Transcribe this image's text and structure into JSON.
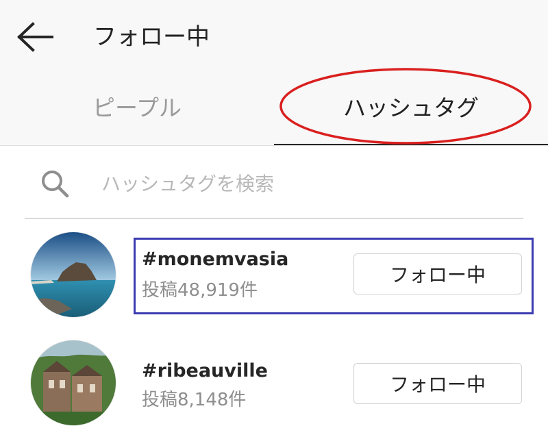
{
  "header": {
    "title": "フォロー中",
    "back_icon": "arrow-left-icon"
  },
  "tabs": [
    {
      "label": "ピープル",
      "active": false
    },
    {
      "label": "ハッシュタグ",
      "active": true
    }
  ],
  "search": {
    "placeholder": "ハッシュタグを検索",
    "value": "",
    "icon": "search-icon"
  },
  "hashtags": [
    {
      "name": "#monemvasia",
      "posts": "投稿48,919件",
      "button_label": "フォロー中"
    },
    {
      "name": "#ribeauville",
      "posts": "投稿8,148件",
      "button_label": "フォロー中"
    }
  ],
  "colors": {
    "header_bg": "#f8f8f8",
    "annotation_ellipse": "#d9201f",
    "annotation_rect": "#3b3bb3",
    "inactive_tab": "#9a9a9a"
  }
}
